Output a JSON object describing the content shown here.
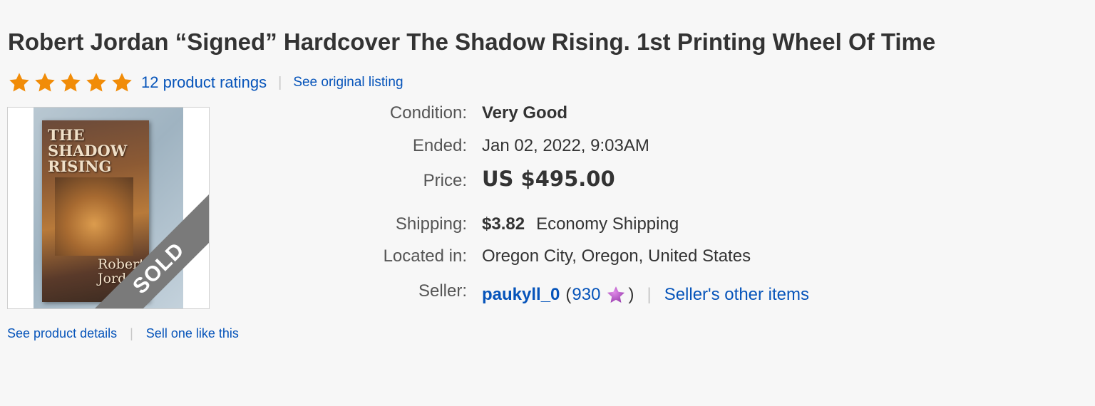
{
  "listing": {
    "title": "Robert Jordan “Signed” Hardcover The Shadow Rising. 1st Printing Wheel Of Time",
    "star_rating": 5,
    "ratings_label": "12 product ratings",
    "separator": "|",
    "original_listing_label": "See original listing"
  },
  "image": {
    "cover_title_line1": "THE SHADOW",
    "cover_title_line2": "RISING",
    "cover_author_line1": "Robert",
    "cover_author_line2": "Jorda",
    "sold_label": "SOLD"
  },
  "links": {
    "product_details": "See product details",
    "sell_one": "Sell one like this"
  },
  "details": {
    "condition_label": "Condition:",
    "condition_value": "Very Good",
    "ended_label": "Ended:",
    "ended_date": "Jan 02, 2022",
    "ended_time": ", 9:03AM",
    "price_label": "Price:",
    "price_value": "US $495.00",
    "shipping_label": "Shipping:",
    "shipping_cost": "$3.82",
    "shipping_method": "Economy Shipping",
    "located_label": "Located in:",
    "located_value": "Oregon City, Oregon, United States",
    "seller_label": "Seller:",
    "seller_name": "paukyll_0",
    "feedback_open": "(",
    "feedback_score": "930",
    "feedback_close": ")",
    "seller_other_items": "Seller's other items"
  },
  "colors": {
    "link": "#0654ba",
    "star_gold": "#f18c08",
    "star_purple": "#9b3fb0",
    "sold_ribbon": "#7a7a7a"
  },
  "icons": {
    "rating_star": "star-icon",
    "feedback_star": "purple-star-icon"
  }
}
